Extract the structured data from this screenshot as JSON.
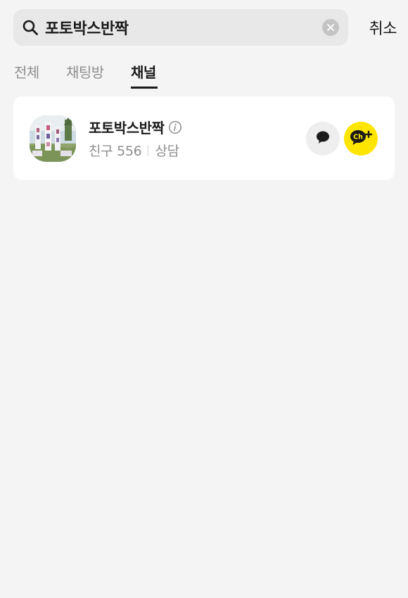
{
  "search": {
    "value": "포토박스반짝",
    "cancel_label": "취소"
  },
  "tabs": [
    {
      "label": "전체",
      "active": false
    },
    {
      "label": "채팅방",
      "active": false
    },
    {
      "label": "채널",
      "active": true
    }
  ],
  "results": [
    {
      "name": "포토박스반짝",
      "friends_label": "친구 556",
      "consult_label": "상담"
    }
  ],
  "colors": {
    "background": "#f4f4f4",
    "card": "#ffffff",
    "channel_add_button": "#fee500",
    "chat_button": "#eeeeee"
  },
  "icons": {
    "search": "search-icon",
    "clear": "clear-icon",
    "info": "info-icon",
    "chat": "chat-bubble-icon",
    "channel_add": "channel-add-icon"
  }
}
